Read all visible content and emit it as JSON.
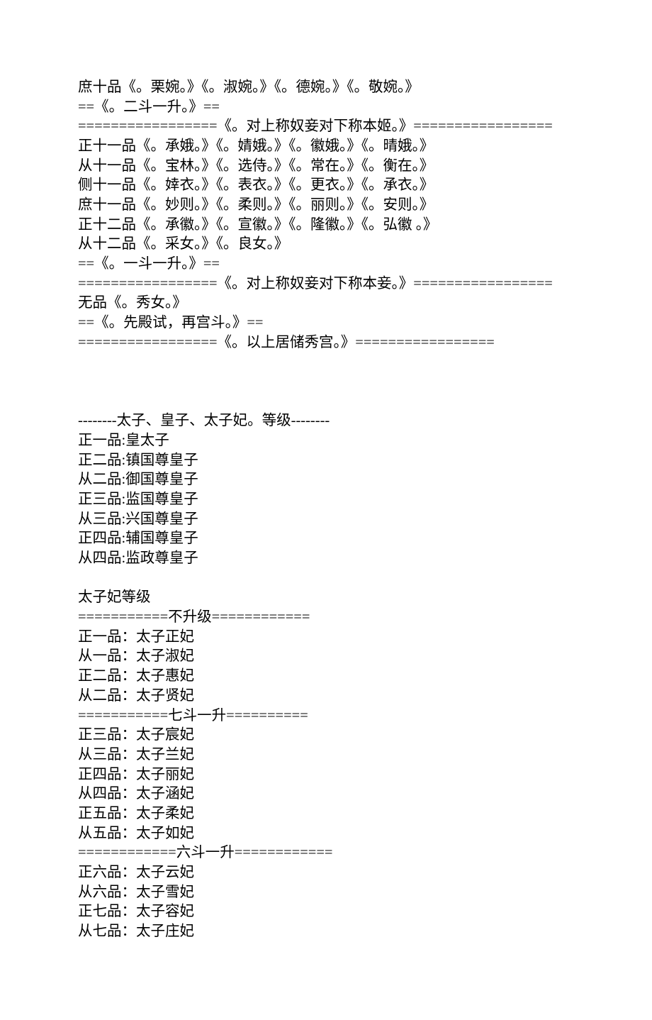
{
  "lines": [
    "庶十品《。栗婉。》《。淑婉。》《。德婉。》《。敬婉。》",
    "==《。二斗一升。》==",
    "=================《。对上称奴妾对下称本姬。》=================",
    "正十一品《。承娥。》《。婧娥。》《。徽娥。》《。晴娥。》",
    "从十一品《。宝林。》《。选侍。》《。常在。》《。衡在。》",
    "侧十一品《。婞衣。》《。表衣。》《。更衣。》《。承衣。》",
    "庶十一品《。妙则。》《。柔则。》《。丽则。》《。安则。》",
    "正十二品《。承徽。》《。宣徽。》《。隆徽。》《。弘徽 。》",
    "从十二品《。采女。》《。良女。》",
    "==《。一斗一升。》==",
    "=================《。对上称奴妾对下称本妾。》=================",
    "无品《。秀女。》",
    "==《。先殿试，再宫斗。》==",
    "=================《。以上居储秀宫。》=================",
    "",
    "",
    "",
    "--------太子、皇子、太子妃。等级--------",
    "正一品:皇太子",
    "正二品:镇国尊皇子",
    "从二品:御国尊皇子",
    "正三品:监国尊皇子",
    "从三品:兴国尊皇子",
    "正四品:辅国尊皇子",
    "从四品:监政尊皇子",
    "",
    "太子妃等级",
    "===========不升级============",
    "正一品：太子正妃",
    "从一品：太子淑妃",
    "正二品：太子惠妃",
    "从二品：太子贤妃",
    "===========七斗一升==========",
    "正三品：太子宸妃",
    "从三品：太子兰妃",
    "正四品：太子丽妃",
    "从四品：太子涵妃",
    "正五品：太子柔妃",
    "从五品：太子如妃",
    "============六斗一升============",
    "正六品：太子云妃",
    "从六品：太子雪妃",
    "正七品：太子容妃",
    "从七品：太子庄妃"
  ]
}
